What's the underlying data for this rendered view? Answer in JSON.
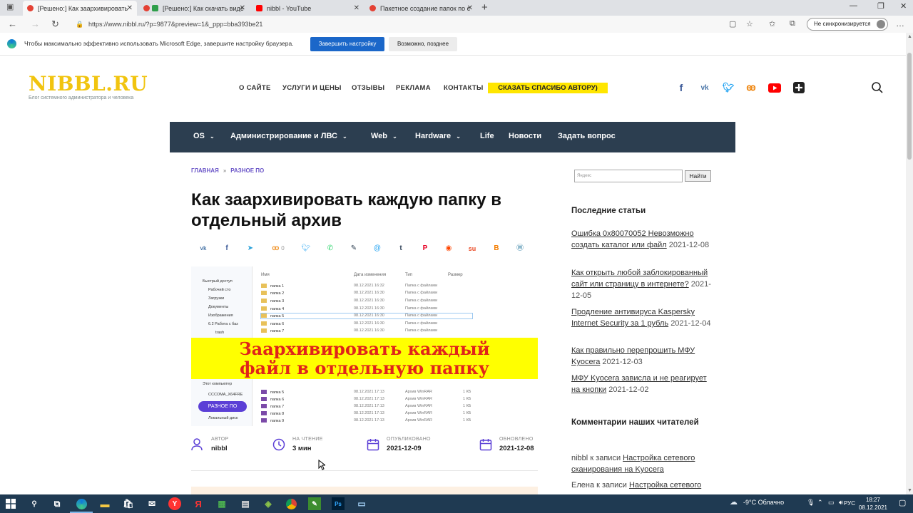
{
  "browser": {
    "tabs": [
      {
        "label": "[Решено:] Как заархивировать",
        "fav": "#e44134",
        "active": true
      },
      {
        "label": "[Решено:] Как скачать виде",
        "fav": "#2e9e4a",
        "active": false
      },
      {
        "label": "nibbl - YouTube",
        "fav": "#ff0000",
        "active": false
      },
      {
        "label": "Пакетное создание папок по с",
        "fav": "#e44134",
        "active": false
      }
    ],
    "url": "https://www.nibbl.ru/?p=9877&preview=1&_ppp=bba393be21",
    "sync_label": "Не синхронизируется",
    "infobar_message": "Чтобы максимально эффективно использовать Microsoft Edge, завершите настройку браузера.",
    "infobar_primary": "Завершить настройку",
    "infobar_secondary": "Возможно, позднее"
  },
  "site": {
    "logo": "NIBBL.RU",
    "tagline": "Блог системного администратора и человека",
    "topnav": [
      "О САЙТЕ",
      "УСЛУГИ И ЦЕНЫ",
      "ОТЗЫВЫ",
      "РЕКЛАМА",
      "КОНТАКТЫ"
    ],
    "thanks": "СКАЗАТЬ СПАСИБО АВТОРУ)",
    "social_icons": [
      "facebook-icon",
      "vk-icon",
      "twitter-icon",
      "odnoklassniki-icon",
      "youtube-icon",
      "plus-icon"
    ],
    "mainnav": [
      {
        "label": "OS",
        "dropdown": true
      },
      {
        "label": "Администрирование и ЛВС",
        "dropdown": true
      },
      {
        "label": "Web",
        "dropdown": true
      },
      {
        "label": "Hardware",
        "dropdown": true
      },
      {
        "label": "Life",
        "dropdown": false
      },
      {
        "label": "Новости",
        "dropdown": false
      },
      {
        "label": "Задать вопрос",
        "dropdown": false
      }
    ]
  },
  "article": {
    "breadcrumb": [
      "ГЛАВНАЯ",
      "»",
      "РАЗНОЕ ПО"
    ],
    "title": "Как заархивировать каждую папку в отдельный архив",
    "share_count": "0",
    "hero": {
      "sidebar": [
        "Быстрый доступ",
        "Рабочий сто",
        "Загрузки",
        "Документы",
        "Изображения",
        "6.2 Работа с баз",
        "trash",
        "Этот компьютер",
        "CCCOMA_X64FRE",
        "Локальный диск"
      ],
      "headers": [
        "Имя",
        "Дата изменения",
        "Тип",
        "Размер"
      ],
      "folders": [
        "папка 1",
        "папка 2",
        "папка 3",
        "папка 4",
        "папка 5",
        "папка 6",
        "папка 7"
      ],
      "folder_date": [
        "08.12.2021 16:32",
        "08.12.2021 16:30",
        "08.12.2021 16:30",
        "08.12.2021 16:30",
        "08.12.2021 16:30",
        "08.12.2021 16:30",
        "08.12.2021 16:30"
      ],
      "folder_type": "Папка с файлами",
      "archives": [
        "папка 5",
        "папка 6",
        "папка 7",
        "папка 8",
        "папка 9"
      ],
      "archive_date": "08.12.2021 17:13",
      "archive_type": "Архив WinRAR",
      "archive_size": "1 КБ",
      "band_line1": "Заархивировать каждый",
      "band_line2": "файл в отдельную папку",
      "pill": "РАЗНОЕ ПО"
    },
    "meta": [
      {
        "label": "АВТОР",
        "value": "nibbl"
      },
      {
        "label": "НА ЧТЕНИЕ",
        "value": "3 мин"
      },
      {
        "label": "ОПУБЛИКОВАНО",
        "value": "2021-12-09"
      },
      {
        "label": "ОБНОВЛЕНО",
        "value": "2021-12-08"
      }
    ]
  },
  "sidebar": {
    "search_placeholder": "Яндекс",
    "search_button": "Найти",
    "recent_title": "Последние статьи",
    "recent": [
      {
        "title": "Ошибка 0x80070052 Невозможно создать каталог или файл",
        "date": "2021-12-08"
      },
      {
        "title": "Как открыть любой заблокированный сайт или страницу в интернете?",
        "date": "2021-12-05"
      },
      {
        "title": "Продление антивируса Kaspersky Internet Security за 1 рубль",
        "date": "2021-12-04"
      },
      {
        "title": "Как правильно перепрошить МФУ Kyocera",
        "date": "2021-12-03"
      },
      {
        "title": "МФУ Kyocera зависла и не реагирует на кнопки",
        "date": "2021-12-02"
      }
    ],
    "comments_title": "Комментарии наших читателей",
    "comments": [
      {
        "author": "nibbl",
        "sep": "к записи",
        "post": "Настройка сетевого сканирования на Kyocera"
      },
      {
        "author": "Елена",
        "sep": "к записи",
        "post": "Настройка сетевого"
      }
    ]
  },
  "taskbar": {
    "weather": "-9°C  Облачно",
    "lang": "РУС",
    "time": "18:27",
    "date": "08.12.2021"
  }
}
